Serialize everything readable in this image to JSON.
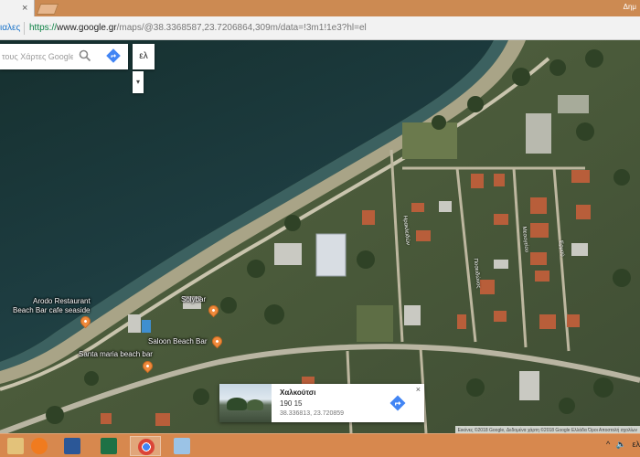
{
  "browser": {
    "tab_close": "×",
    "window_label": "Δημ",
    "back_label": "ιαλες",
    "url_secure": "https://",
    "url_host": "www.google.gr",
    "url_path": "/maps/@38.3368587,23.7206864,309m/data=!3m1!1e3?hl=el"
  },
  "map": {
    "search_placeholder": "τους Χάρτες Google",
    "lang_button": "ελ",
    "lang_caret": "▾",
    "pois": {
      "arodo_line1": "Arodo Restaurant",
      "arodo_line2": "Beach Bar cafe seaside",
      "solybar": "Solybar",
      "saloon": "Saloon Beach Bar",
      "santa_maria": "Santa maria beach bar"
    },
    "road_labels": {
      "r1": "Ηρακλειδών",
      "r2": "Ποσειδώνος",
      "r3": "Μεσογείου",
      "r4": "Ερμού"
    },
    "icons": {
      "search": "search-icon",
      "directions": "directions-icon",
      "pin": "map-pin-icon"
    },
    "colors": {
      "sea": "#1c3a3e",
      "pin": "#f08a3c",
      "directions": "#4285f4"
    }
  },
  "infocard": {
    "title": "Χαλκούτσι",
    "postcode": "190 15",
    "coords": "38.336813, 23.720859",
    "close": "×"
  },
  "attribution": "Εικόνες ©2018 Google, Δεδομένα χάρτη ©2018 Google   Ελλάδα   Όροι   Αποστολή σχολίων",
  "taskbar": {
    "tray_chevron": "^",
    "tray_volume": "🔈",
    "tray_lang": "ελ"
  }
}
